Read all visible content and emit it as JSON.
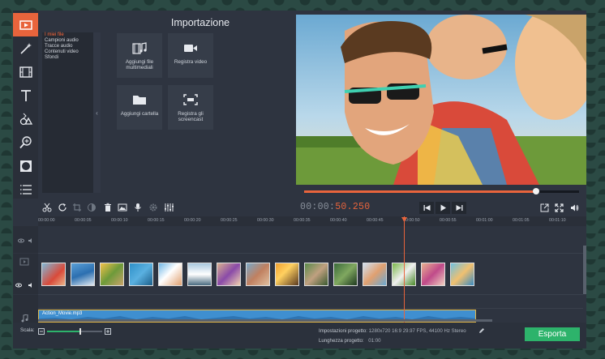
{
  "panel": {
    "title": "Importazione"
  },
  "categories": [
    {
      "label": "I miei file",
      "active": true
    },
    {
      "label": "Campioni audio",
      "active": false
    },
    {
      "label": "Tracce audio",
      "active": false
    },
    {
      "label": "Contenuti video",
      "active": false
    },
    {
      "label": "Sfondi",
      "active": false
    }
  ],
  "tiles": [
    {
      "label": "Aggiungi file multimediali",
      "icon": "add-media-icon"
    },
    {
      "label": "Registra video",
      "icon": "camera-icon"
    },
    {
      "label": "Aggiungi cartella",
      "icon": "folder-icon"
    },
    {
      "label": "Registra gli screencast",
      "icon": "screencast-icon"
    }
  ],
  "sidebar_tools": [
    "media-icon",
    "magic-wand-icon",
    "filmstrip-icon",
    "text-icon",
    "shapes-icon",
    "zoom-icon",
    "vignette-icon",
    "list-icon"
  ],
  "timecode": {
    "prefix": "00:00:",
    "highlight": "50.250"
  },
  "playback": {
    "progress": 0.844
  },
  "ruler": [
    "00:00:00",
    "00:00:05",
    "00:00:10",
    "00:00:15",
    "00:00:20",
    "00:00:25",
    "00:00:30",
    "00:00:35",
    "00:00:40",
    "00:00:45",
    "00:00:50",
    "00:00:55",
    "00:01:00",
    "00:01:05",
    "00:01:10"
  ],
  "audio": {
    "file": "Action_Movie.mp3"
  },
  "bottom": {
    "scale_label": "Scala:",
    "scale_value": 0.6,
    "settings_label": "Impostazioni progetto:",
    "settings_value": "1280x720 16:9 29.97 FPS, 44100 Hz Stereo",
    "length_label": "Lunghezza progetto:",
    "length_value": "01:00",
    "export_label": "Esporta"
  },
  "colors": {
    "accent": "#e8643c",
    "export": "#2db36b",
    "audio": "#3f8fd0"
  }
}
